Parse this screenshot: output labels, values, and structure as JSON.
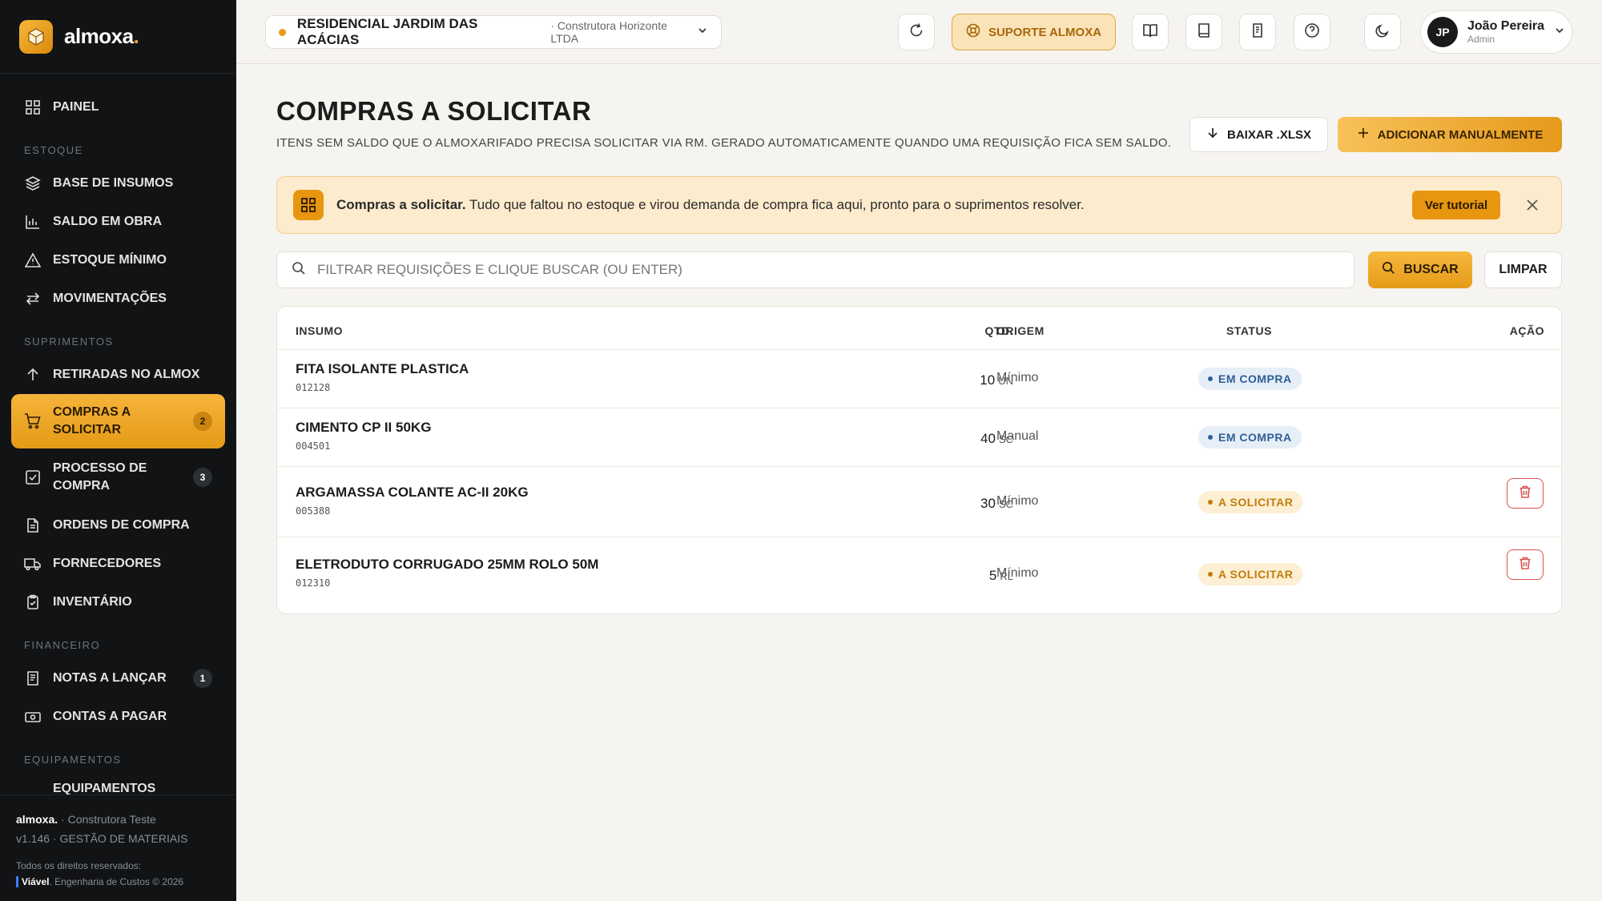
{
  "app": {
    "logo_text": "almoxa",
    "logo_dot": "."
  },
  "sidebar": {
    "items": [
      {
        "label": "PAINEL",
        "icon": "grid-icon"
      }
    ],
    "sections": [
      {
        "title": "ESTOQUE",
        "items": [
          {
            "label": "BASE DE INSUMOS",
            "icon": "layers-icon"
          },
          {
            "label": "SALDO EM OBRA",
            "icon": "bar-chart-icon"
          },
          {
            "label": "ESTOQUE MÍNIMO",
            "icon": "warning-icon"
          },
          {
            "label": "MOVIMENTAÇÕES",
            "icon": "arrows-swap-icon"
          }
        ]
      },
      {
        "title": "SUPRIMENTOS",
        "items": [
          {
            "label": "RETIRADAS NO ALMOX",
            "icon": "arrow-up-icon"
          },
          {
            "label": "COMPRAS A SOLICITAR",
            "icon": "cart-icon",
            "badge": "2",
            "active": true
          },
          {
            "label": "PROCESSO DE COMPRA",
            "icon": "check-square-icon",
            "badge": "3"
          },
          {
            "label": "ORDENS DE COMPRA",
            "icon": "document-icon"
          },
          {
            "label": "FORNECEDORES",
            "icon": "truck-icon"
          },
          {
            "label": "INVENTÁRIO",
            "icon": "clipboard-icon"
          }
        ]
      },
      {
        "title": "FINANCEIRO",
        "items": [
          {
            "label": "NOTAS A LANÇAR",
            "icon": "receipt-icon",
            "badge": "1"
          },
          {
            "label": "CONTAS A PAGAR",
            "icon": "money-icon"
          }
        ]
      },
      {
        "title": "EQUIPAMENTOS",
        "items": [
          {
            "label": "EQUIPAMENTOS",
            "icon": "tool-icon"
          }
        ]
      }
    ],
    "footer": {
      "brand": "almoxa.",
      "company": " · Construtora Teste",
      "version": "v1.146 · GESTÃO DE MATERIAIS",
      "rights": "Todos os direitos reservados:",
      "viavel": "Viável",
      "viavel_rest": ". Engenharia de Custos © 2026"
    }
  },
  "topbar": {
    "project_name": "RESIDENCIAL JARDIM DAS ACÁCIAS",
    "project_company": "· Construtora Horizonte LTDA",
    "support_label": "SUPORTE ALMOXA",
    "user_initials": "JP",
    "user_name": "João Pereira",
    "user_role": "Admin"
  },
  "page": {
    "title": "COMPRAS A SOLICITAR",
    "subtitle": "Itens sem saldo que o almoxarifado precisa solicitar via RM. Gerado automaticamente quando uma requisição fica sem saldo.",
    "btn_xlsx": "BAIXAR .XLSX",
    "btn_add": "ADICIONAR MANUALMENTE"
  },
  "banner": {
    "title": "Compras a solicitar.",
    "text": " Tudo que faltou no estoque e virou demanda de compra fica aqui, pronto para o suprimentos resolver.",
    "button": "Ver tutorial"
  },
  "search": {
    "placeholder": "Filtrar requisições e clique buscar (ou enter)",
    "value": "",
    "btn_search": "BUSCAR",
    "btn_clear": "LIMPAR"
  },
  "table": {
    "headers": {
      "item": "INSUMO",
      "qty": "QTD.",
      "origin": "ORIGEM",
      "status": "STATUS",
      "action": "AÇÃO"
    },
    "rows": [
      {
        "name": "FITA ISOLANTE PLASTICA",
        "code": "012128",
        "qty": "10",
        "unit": "UN",
        "origin": "Mínimo",
        "status": "EM COMPRA",
        "status_type": "buy",
        "deletable": false
      },
      {
        "name": "CIMENTO CP II 50KG",
        "code": "004501",
        "qty": "40",
        "unit": "SC",
        "origin": "Manual",
        "status": "EM COMPRA",
        "status_type": "buy",
        "deletable": false
      },
      {
        "name": "ARGAMASSA COLANTE AC-II 20KG",
        "code": "005388",
        "qty": "30",
        "unit": "SC",
        "origin": "Mínimo",
        "status": "A SOLICITAR",
        "status_type": "req",
        "deletable": true
      },
      {
        "name": "ELETRODUTO CORRUGADO 25MM ROLO 50M",
        "code": "012310",
        "qty": "5",
        "unit": "RL",
        "origin": "Mínimo",
        "status": "A SOLICITAR",
        "status_type": "req",
        "deletable": true
      }
    ]
  },
  "colors": {
    "accent": "#e8950f",
    "sidebar_bg": "#111315",
    "page_bg": "#f6f4f0",
    "danger": "#d9534f",
    "status_buy": "#2f5e97",
    "status_req": "#c27c0c"
  }
}
